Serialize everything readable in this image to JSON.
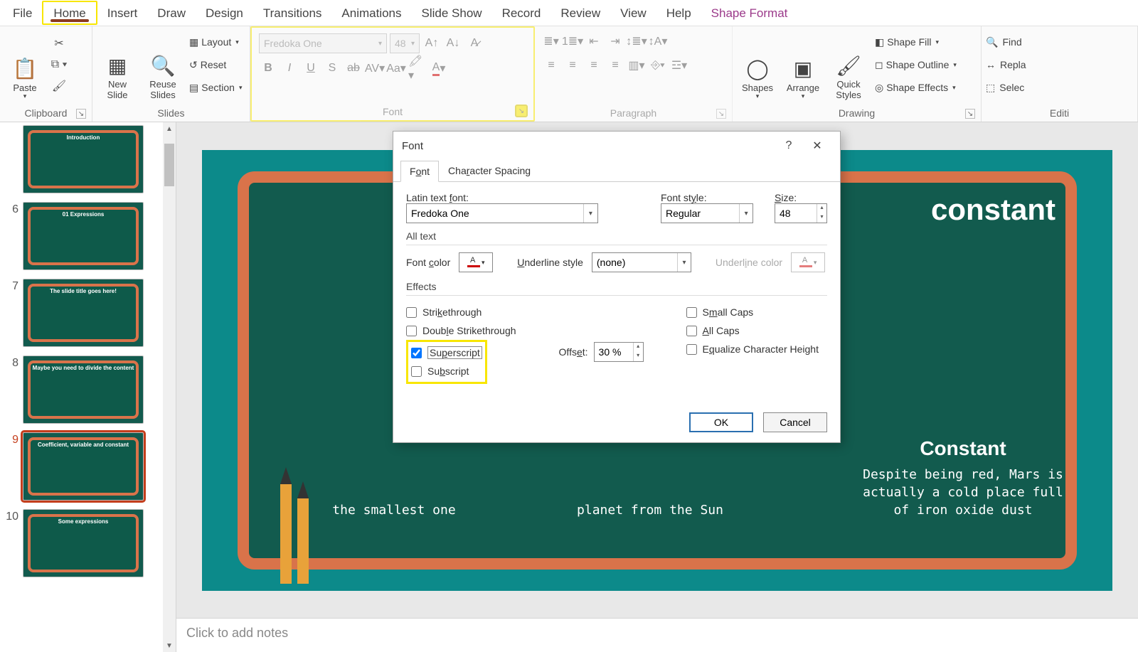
{
  "menu": {
    "file": "File",
    "home": "Home",
    "insert": "Insert",
    "draw": "Draw",
    "design": "Design",
    "transitions": "Transitions",
    "animations": "Animations",
    "slideshow": "Slide Show",
    "record": "Record",
    "review": "Review",
    "view": "View",
    "help": "Help",
    "shapeformat": "Shape Format"
  },
  "ribbon": {
    "clipboard": {
      "label": "Clipboard",
      "paste": "Paste"
    },
    "slides": {
      "label": "Slides",
      "newslide": "New\nSlide",
      "reuse": "Reuse\nSlides",
      "layout": "Layout",
      "reset": "Reset",
      "section": "Section"
    },
    "font": {
      "label": "Font",
      "name": "Fredoka One",
      "size": "48"
    },
    "paragraph": {
      "label": "Paragraph"
    },
    "drawing": {
      "label": "Drawing",
      "shapes": "Shapes",
      "arrange": "Arrange",
      "quick": "Quick\nStyles",
      "fill": "Shape Fill",
      "outline": "Shape Outline",
      "effects": "Shape Effects"
    },
    "editing": {
      "label": "Editi",
      "find": "Find",
      "replace": "Repla",
      "select": "Selec"
    }
  },
  "thumbs": [
    {
      "num": "",
      "title": "Introduction"
    },
    {
      "num": "6",
      "title": "01 Expressions"
    },
    {
      "num": "7",
      "title": "The slide title goes here!"
    },
    {
      "num": "8",
      "title": "Maybe you need to divide the content"
    },
    {
      "num": "9",
      "title": "Coefficient, variable and constant",
      "active": true
    },
    {
      "num": "10",
      "title": "Some expressions"
    }
  ],
  "slide": {
    "title": "constant",
    "col1_title": "",
    "col1_text": "the smallest one",
    "col2_title": "",
    "col2_text": "planet from the Sun",
    "col3_title": "Constant",
    "col3_text": "Despite being red, Mars is actually a cold place full of iron oxide dust"
  },
  "notes_placeholder": "Click to add notes",
  "dialog": {
    "title": "Font",
    "help": "?",
    "close": "✕",
    "tab_font": "Font",
    "tab_spacing": "Character Spacing",
    "latin_label": "Latin text font:",
    "latin_value": "Fredoka One",
    "style_label": "Font style:",
    "style_value": "Regular",
    "size_label": "Size:",
    "size_value": "48",
    "alltext": "All text",
    "fontcolor": "Font color",
    "underlinestyle": "Underline style",
    "underlinestyle_value": "(none)",
    "underlinecolor": "Underline color",
    "effects": "Effects",
    "strike": "Strikethrough",
    "dblstrike": "Double Strikethrough",
    "superscript": "Superscript",
    "subscript": "Subscript",
    "offset_label": "Offset:",
    "offset_value": "30 %",
    "smallcaps": "Small Caps",
    "allcaps": "All Caps",
    "equalize": "Equalize Character Height",
    "ok": "OK",
    "cancel": "Cancel"
  }
}
